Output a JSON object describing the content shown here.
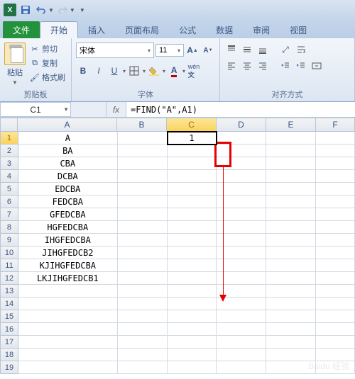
{
  "qat": {
    "save": "💾",
    "undo": "↶",
    "redo": "↷"
  },
  "tabs": {
    "file": "文件",
    "home": "开始",
    "insert": "插入",
    "layout": "页面布局",
    "formulas": "公式",
    "data": "数据",
    "review": "审阅",
    "view": "视图"
  },
  "clipboard": {
    "paste": "粘贴",
    "cut": "剪切",
    "copy": "复制",
    "format_painter": "格式刷",
    "group_label": "剪贴板"
  },
  "font": {
    "name": "宋体",
    "size": "11",
    "group_label": "字体"
  },
  "align": {
    "group_label": "对齐方式"
  },
  "name_box": "C1",
  "formula": "=FIND(\"A\",A1)",
  "columns": [
    "A",
    "B",
    "C",
    "D",
    "E",
    "F"
  ],
  "active_col": "C",
  "active_row": 1,
  "active_value": "1",
  "data_a": [
    "A",
    "BA",
    "CBA",
    "DCBA",
    "EDCBA",
    "FEDCBA",
    "GFEDCBA",
    "HGFEDCBA",
    "IHGFEDCBA",
    "JIHGFEDCB2",
    "KJIHGFEDCBA",
    "LKJIHGFEDCB1"
  ],
  "row_count": 19,
  "watermark": "Baidu 经验"
}
